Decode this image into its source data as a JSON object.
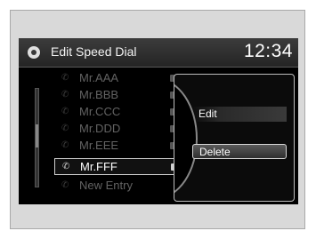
{
  "header": {
    "title": "Edit Speed Dial",
    "clock": "12:34"
  },
  "entries": [
    {
      "label": "Mr.AAA",
      "icon": "phone-icon"
    },
    {
      "label": "Mr.BBB",
      "icon": "phone-icon"
    },
    {
      "label": "Mr.CCC",
      "icon": "phone-icon"
    },
    {
      "label": "Mr.DDD",
      "icon": "phone-icon"
    },
    {
      "label": "Mr.EEE",
      "icon": "phone-icon"
    },
    {
      "label": "Mr.FFF",
      "icon": "phone-icon"
    },
    {
      "label": "New Entry",
      "icon": "phone-icon"
    }
  ],
  "popup_menu": {
    "items": [
      {
        "label": "Edit"
      },
      {
        "label": "Delete"
      }
    ]
  }
}
